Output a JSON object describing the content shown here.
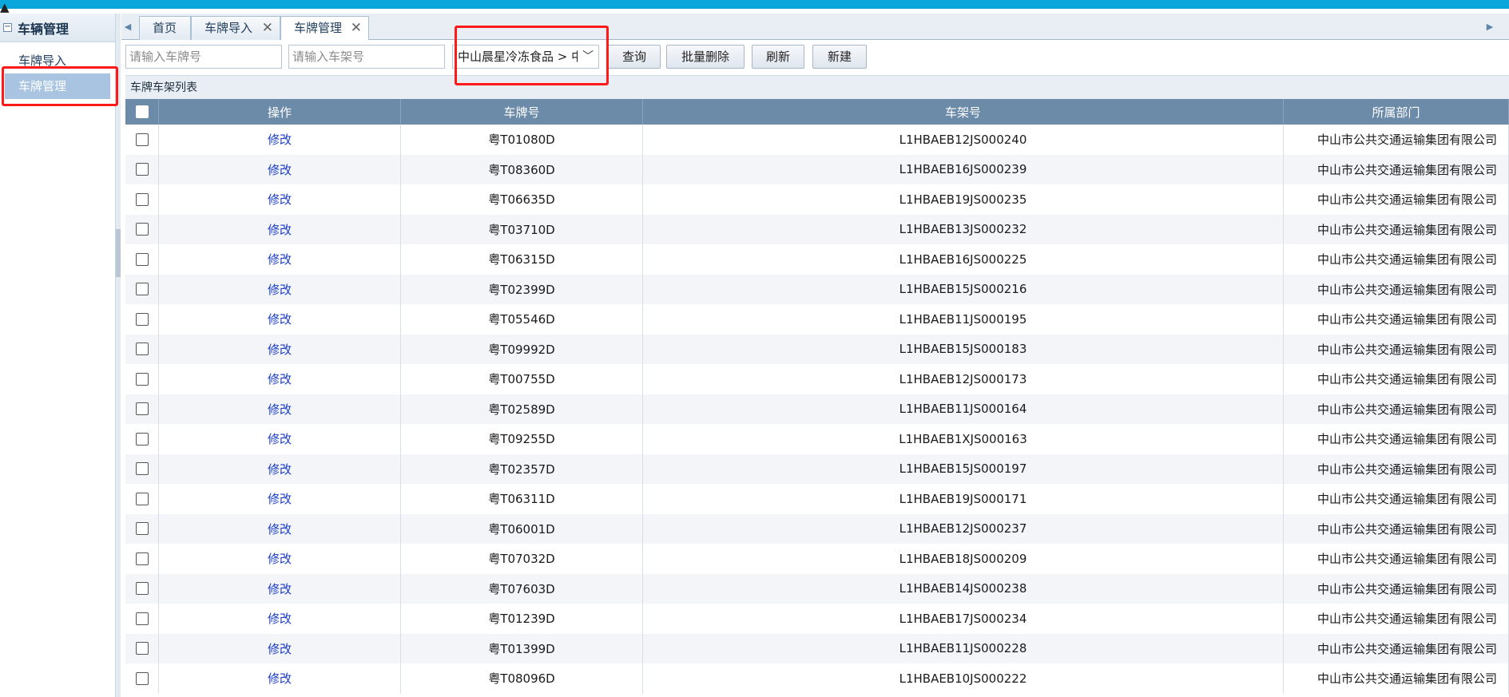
{
  "sidebar": {
    "title": "车辆管理",
    "collapse_glyph": "⊟",
    "items": [
      {
        "label": "车牌导入"
      },
      {
        "label": "车牌管理"
      }
    ]
  },
  "tabs": [
    {
      "label": "首页",
      "closable": false
    },
    {
      "label": "车牌导入",
      "closable": true
    },
    {
      "label": "车牌管理",
      "closable": true
    }
  ],
  "toolbar": {
    "plate_placeholder": "请输入车牌号",
    "frame_placeholder": "请输入车架号",
    "dept_select_value": "中山晨星冷冻食品 > 中",
    "query_label": "查询",
    "batch_delete_label": "批量删除",
    "refresh_label": "刷新",
    "new_label": "新建"
  },
  "grid": {
    "title": "车牌车架列表",
    "columns": [
      "操作",
      "车牌号",
      "车架号",
      "所属部门"
    ],
    "edit_label": "修改",
    "rows": [
      {
        "plate": "粤T01080D",
        "frame": "L1HBAEB12JS000240",
        "dept": "中山市公共交通运输集团有限公司"
      },
      {
        "plate": "粤T08360D",
        "frame": "L1HBAEB16JS000239",
        "dept": "中山市公共交通运输集团有限公司"
      },
      {
        "plate": "粤T06635D",
        "frame": "L1HBAEB19JS000235",
        "dept": "中山市公共交通运输集团有限公司"
      },
      {
        "plate": "粤T03710D",
        "frame": "L1HBAEB13JS000232",
        "dept": "中山市公共交通运输集团有限公司"
      },
      {
        "plate": "粤T06315D",
        "frame": "L1HBAEB16JS000225",
        "dept": "中山市公共交通运输集团有限公司"
      },
      {
        "plate": "粤T02399D",
        "frame": "L1HBAEB15JS000216",
        "dept": "中山市公共交通运输集团有限公司"
      },
      {
        "plate": "粤T05546D",
        "frame": "L1HBAEB11JS000195",
        "dept": "中山市公共交通运输集团有限公司"
      },
      {
        "plate": "粤T09992D",
        "frame": "L1HBAEB15JS000183",
        "dept": "中山市公共交通运输集团有限公司"
      },
      {
        "plate": "粤T00755D",
        "frame": "L1HBAEB12JS000173",
        "dept": "中山市公共交通运输集团有限公司"
      },
      {
        "plate": "粤T02589D",
        "frame": "L1HBAEB11JS000164",
        "dept": "中山市公共交通运输集团有限公司"
      },
      {
        "plate": "粤T09255D",
        "frame": "L1HBAEB1XJS000163",
        "dept": "中山市公共交通运输集团有限公司"
      },
      {
        "plate": "粤T02357D",
        "frame": "L1HBAEB15JS000197",
        "dept": "中山市公共交通运输集团有限公司"
      },
      {
        "plate": "粤T06311D",
        "frame": "L1HBAEB19JS000171",
        "dept": "中山市公共交通运输集团有限公司"
      },
      {
        "plate": "粤T06001D",
        "frame": "L1HBAEB12JS000237",
        "dept": "中山市公共交通运输集团有限公司"
      },
      {
        "plate": "粤T07032D",
        "frame": "L1HBAEB18JS000209",
        "dept": "中山市公共交通运输集团有限公司"
      },
      {
        "plate": "粤T07603D",
        "frame": "L1HBAEB14JS000238",
        "dept": "中山市公共交通运输集团有限公司"
      },
      {
        "plate": "粤T01239D",
        "frame": "L1HBAEB17JS000234",
        "dept": "中山市公共交通运输集团有限公司"
      },
      {
        "plate": "粤T01399D",
        "frame": "L1HBAEB11JS000228",
        "dept": "中山市公共交通运输集团有限公司"
      },
      {
        "plate": "粤T08096D",
        "frame": "L1HBAEB10JS000222",
        "dept": "中山市公共交通运输集团有限公司"
      }
    ]
  },
  "colors": {
    "topbar": "#0aa6dc",
    "grid_header": "#6c8ba9",
    "active_sidebar": "#a8c4e0",
    "edit_link": "#1a3cc8",
    "highlight_box": "#ff1a1a"
  }
}
